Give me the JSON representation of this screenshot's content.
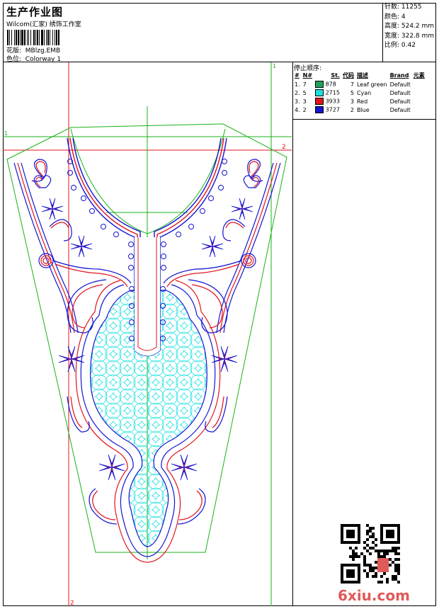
{
  "header": {
    "title": "生产作业图",
    "company": "Wilcom(汇家) 绣饰工作室",
    "design_label": "花版:",
    "design_file": "MBlzg.EMB",
    "colorway_label": "色位:",
    "colorway": "Colorway 1"
  },
  "stats": {
    "stitches": "针数: 11255",
    "colors": "颜色: 4",
    "height": "高度: 524.2 mm",
    "width": "宽度: 322.8 mm",
    "scale": "比例: 0.42"
  },
  "stop_sequence": {
    "title": "停止顺序:",
    "headers": [
      "#",
      "N#",
      "St.",
      "代码",
      "描述",
      "Brand",
      "元素"
    ],
    "rows": [
      {
        "idx": "1.",
        "n": "7",
        "st": "878",
        "code": "7",
        "desc": "Leaf green",
        "brand": "Default",
        "color": "#1fa35a"
      },
      {
        "idx": "2.",
        "n": "5",
        "st": "2715",
        "code": "5",
        "desc": "Cyan",
        "brand": "Default",
        "color": "#19e0e0"
      },
      {
        "idx": "3.",
        "n": "3",
        "st": "3933",
        "code": "3",
        "desc": "Red",
        "brand": "Default",
        "color": "#e0141e"
      },
      {
        "idx": "4.",
        "n": "2",
        "st": "3727",
        "code": "2",
        "desc": "Blue",
        "brand": "Default",
        "color": "#1414d2"
      }
    ]
  },
  "guides": {
    "marker_1_top": "1",
    "marker_1_left": "1",
    "marker_2_right": "2",
    "marker_2_bottom": "2"
  },
  "watermark": "6xiu.com",
  "colors": {
    "guide_red": "#e0141e",
    "guide_green": "#19b219",
    "fill_cyan": "#19e0e0",
    "outline_blue": "#1414d2",
    "outline_red": "#e0141e",
    "leaf_green": "#1fa35a"
  }
}
